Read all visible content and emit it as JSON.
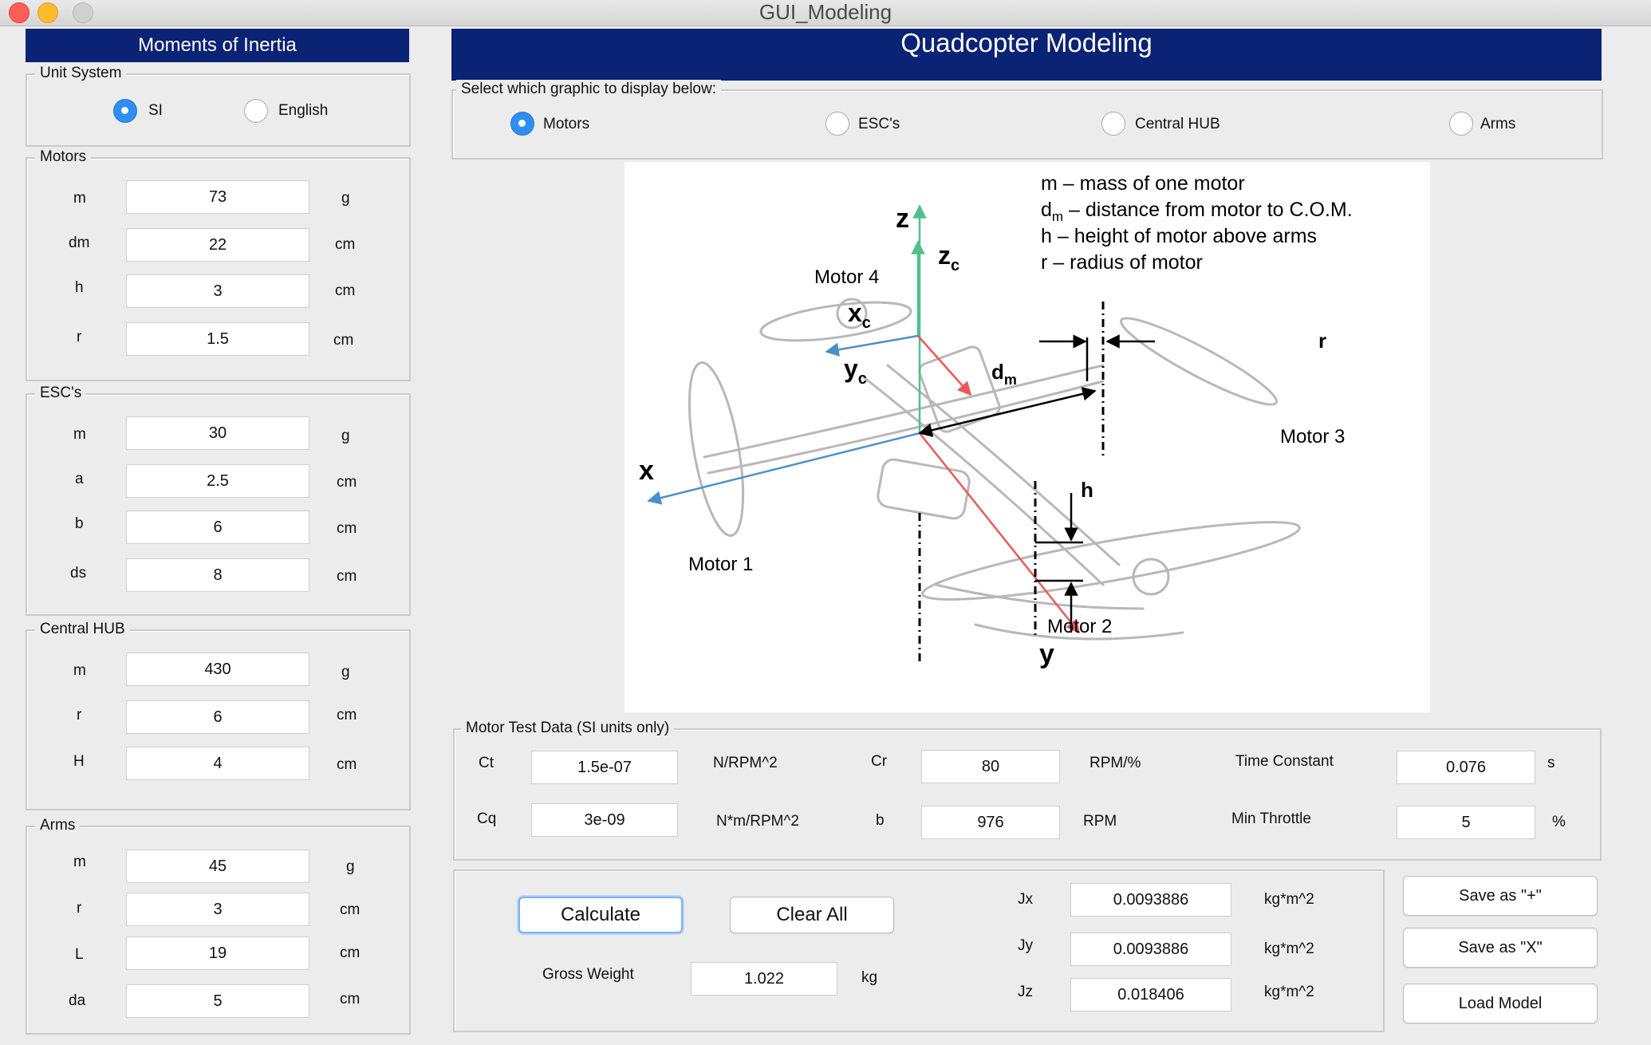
{
  "window": {
    "title": "GUI_Modeling"
  },
  "left_header": "Moments of Inertia",
  "main_header": "Quadcopter Modeling",
  "unit_system": {
    "label": "Unit System",
    "options": [
      "SI",
      "English"
    ],
    "selected": "SI"
  },
  "motors": {
    "label": "Motors",
    "rows": [
      {
        "name": "m",
        "value": "73",
        "unit": "g"
      },
      {
        "name": "dm",
        "value": "22",
        "unit": "cm"
      },
      {
        "name": "h",
        "value": "3",
        "unit": "cm"
      },
      {
        "name": "r",
        "value": "1.5",
        "unit": "cm"
      }
    ]
  },
  "escs": {
    "label": "ESC's",
    "rows": [
      {
        "name": "m",
        "value": "30",
        "unit": "g"
      },
      {
        "name": "a",
        "value": "2.5",
        "unit": "cm"
      },
      {
        "name": "b",
        "value": "6",
        "unit": "cm"
      },
      {
        "name": "ds",
        "value": "8",
        "unit": "cm"
      }
    ]
  },
  "hub": {
    "label": "Central HUB",
    "rows": [
      {
        "name": "m",
        "value": "430",
        "unit": "g"
      },
      {
        "name": "r",
        "value": "6",
        "unit": "cm"
      },
      {
        "name": "H",
        "value": "4",
        "unit": "cm"
      }
    ]
  },
  "arms": {
    "label": "Arms",
    "rows": [
      {
        "name": "m",
        "value": "45",
        "unit": "g"
      },
      {
        "name": "r",
        "value": "3",
        "unit": "cm"
      },
      {
        "name": "L",
        "value": "19",
        "unit": "cm"
      },
      {
        "name": "da",
        "value": "5",
        "unit": "cm"
      }
    ]
  },
  "graphic_select": {
    "label": "Select which graphic to display below:",
    "options": [
      "Motors",
      "ESC's",
      "Central HUB",
      "Arms"
    ],
    "selected": "Motors"
  },
  "figure": {
    "legend_lines": [
      {
        "pre": "m",
        "sub": "",
        "post": " – mass of one motor"
      },
      {
        "pre": "d",
        "sub": "m",
        "post": " – distance from motor to C.O.M."
      },
      {
        "pre": "h",
        "sub": "",
        "post": " – height of motor above arms"
      },
      {
        "pre": "r",
        "sub": "",
        "post": " – radius of motor"
      }
    ],
    "motor_labels": [
      "Motor 1",
      "Motor 2",
      "Motor 3",
      "Motor 4"
    ],
    "axis_x": "x",
    "axis_y": "y",
    "axis_z": "z",
    "axis_xc": "x",
    "axis_yc": "y",
    "axis_zc": "z",
    "axis_c_sub": "c",
    "dim_dm": "d",
    "dim_dm_sub": "m",
    "dim_h": "h",
    "dim_r": "r",
    "colors": {
      "x_axis": "#4a90c8",
      "y_axis": "#e85a5a",
      "z_axis": "#4fc08d"
    }
  },
  "motor_test": {
    "label": "Motor Test Data  (SI units only)",
    "Ct": {
      "label": "Ct",
      "value": "1.5e-07",
      "unit": "N/RPM^2"
    },
    "Cq": {
      "label": "Cq",
      "value": "3e-09",
      "unit": "N*m/RPM^2"
    },
    "Cr": {
      "label": "Cr",
      "value": "80",
      "unit": "RPM/%"
    },
    "b": {
      "label": "b",
      "value": "976",
      "unit": "RPM"
    },
    "time_constant": {
      "label": "Time Constant",
      "value": "0.076",
      "unit": "s"
    },
    "min_throttle": {
      "label": "Min Throttle",
      "value": "5",
      "unit": "%"
    }
  },
  "results": {
    "calculate": "Calculate",
    "clear_all": "Clear All",
    "gross_weight": {
      "label": "Gross Weight",
      "value": "1.022",
      "unit": "kg"
    },
    "Jx": {
      "label": "Jx",
      "value": "0.0093886",
      "unit": "kg*m^2"
    },
    "Jy": {
      "label": "Jy",
      "value": "0.0093886",
      "unit": "kg*m^2"
    },
    "Jz": {
      "label": "Jz",
      "value": "0.018406",
      "unit": "kg*m^2"
    }
  },
  "actions": {
    "save_plus": "Save as \"+\"",
    "save_x": "Save as \"X\"",
    "load_model": "Load Model"
  },
  "accent_color": "#0b2375"
}
